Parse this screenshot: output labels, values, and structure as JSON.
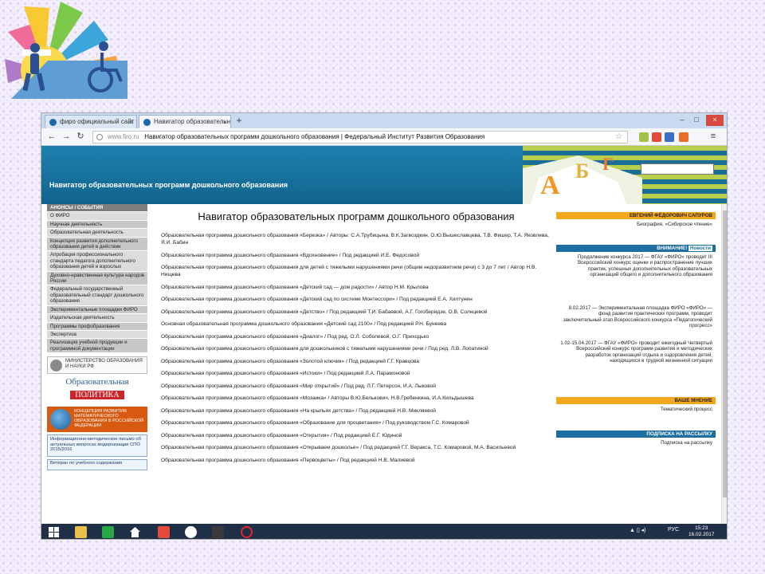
{
  "browser": {
    "tabs": [
      {
        "label": "фиро официальный сайт ©"
      },
      {
        "label": "Навигатор образовательн"
      }
    ],
    "url_domain": "www.firo.ru",
    "url_title": "Навигатор образовательных программ дошкольного образования | Федеральный Институт Развития Образования"
  },
  "site": {
    "header_title": "Навигатор образовательных программ дошкольного образования"
  },
  "sidebar": {
    "items": [
      {
        "label": "АНОНСЫ / СОБЫТИЯ",
        "style": "head"
      },
      {
        "label": "О ФИРО",
        "style": "normal"
      },
      {
        "label": "Научная деятельность",
        "style": "alt"
      },
      {
        "label": "Образовательная деятельность",
        "style": "normal"
      },
      {
        "label": "Концепция развития дополнительного образования детей в действии",
        "style": "alt"
      },
      {
        "label": "Апробация профессионального стандарта педагога дополнительного образования детей и взрослых",
        "style": "normal"
      },
      {
        "label": "Духовно-нравственная культура народов России",
        "style": "alt"
      },
      {
        "label": "Федеральный государственный образовательный стандарт дошкольного образования",
        "style": "normal"
      },
      {
        "label": "Экспериментальные площадки ФИРО",
        "style": "alt"
      },
      {
        "label": "Издательская деятельность",
        "style": "normal"
      },
      {
        "label": "Программы профобразования",
        "style": "alt"
      },
      {
        "label": "Экспертиза",
        "style": "normal"
      },
      {
        "label": "Реализация учебной продукции и программной документации",
        "style": "alt"
      }
    ],
    "ministry": "МИНИСТЕРСТВО ОБРАЗОВАНИЯ И НАУКИ РФ",
    "politika_1": "Образовательная",
    "politika_2": "ПОЛИТИКА",
    "globe_text": "КОНЦЕПЦИЯ РАЗВИТИЯ МАТЕМАТИЧЕСКОГО ОБРАЗОВАНИЯ В РОССИЙСКОЙ ФЕДЕРАЦИИ",
    "info_1": "Информационно-методическое письмо об актуальных вопросах модернизации СПО 2015/2016",
    "info_2": "Ветеран по учебного содержания"
  },
  "main": {
    "title": "Навигатор образовательных программ дошкольного образования",
    "programs": [
      "Образовательная программа дошкольного образования «Березка» / Авторы: С.А.Трубицына, В.К.Загвоздкин, О.Ю.Вышеславцева, Т.В. Фишер, Т.А. Яковлева, Я.И. Бабин",
      "Образовательная программа дошкольного образования «Вдохновение» / Под редакцией И.Е. Федосовой",
      "Образовательная программа дошкольного образования для детей с тяжелыми нарушениями речи (общим недоразвитием речи) с 3 до 7 лет / Автор Н.В. Нищева",
      "Образовательная программа дошкольного образования «Детский сад — дом радости» / Автор Н.М. Крылова",
      "Образовательная программа дошкольного образования «Детский сад по системе Монтессори» / Под редакцией Е.А. Хилтунен",
      "Образовательная программа дошкольного образования «Детство» / Под редакцией Т.И. Бабаевой, А.Г. Гогоберидзе, О.В. Солнцевой",
      "Основная образовательная программа дошкольного образования «Детский сад 2100» / Под редакцией Р.Н. Бунеева",
      "Образовательная программа дошкольного образования «Диалог» / Под ред. О.Л. Соболевой, О.Г. Приходько",
      "Образовательная программа дошкольного образования для дошкольников с тяжелыми нарушениями речи / Под ред. Л.В. Лопатиной",
      "Образовательная программа дошкольного образования «Золотой ключик» / Под редакцией Г.Г. Кравцова",
      "Образовательная программа дошкольного образования «Истоки» / Под редакцией Л.А. Парамоновой",
      "Образовательная программа дошкольного образования «Мир открытий» / Под ред. Л.Г. Петерсон, И.А. Лыковой",
      "Образовательная программа дошкольного образования «Мозаика» / Авторы В.Ю.Белькович, Н.В.Гребенкина, И.А.Кильдышева",
      "Образовательная программа дошкольного образования «На крыльях детства» / Под редакцией Н.В. Микляевой",
      "Образовательная программа дошкольного образования «Образование для процветания» / Под руководством Г.С. Комаровой",
      "Образовательная программа дошкольного образования «Открытия» / Под редакцией Е.Г. Юдиной",
      "Образовательная программа дошкольного образования «Открываем дошколье» / Под редакцией Г.Г. Веракса, Т.С. Комаровой, М.А. Васильевой",
      "Образовательная программа дошкольного образования «Первоцветы» / Под редакцией Н.В. Малиевой"
    ]
  },
  "right": {
    "head_1": "ЕВГЕНИЙ ФЁДОРОВИЧ САПУРОВ",
    "text_1": "Биография, «Сибирское чтение»",
    "head_2": "ВНИМАНИЕ!",
    "head_2_link": "Новости",
    "text_2": "Продолжение конкурса 2017 — ФГАУ «ФИРО» проводит III Всероссийский конкурс оценки и распространение лучших практик, успешных дополнительных образовательных организаций общего и дополнительного образования",
    "text_3": "8.02.2017 — Экспериментальная площадка ФИРО «ФИРО» — фонд развития практических программ, проводит заключительный этап Всероссийского конкурса «Педагогический прогресс»",
    "text_4": "1.02-15.04.2017 — ФГАУ «ФИРО» проводит ежегодный Четвертый Всероссийский конкурс программ развития и методических разработок организаций отдыха и оздоровления детей, находящихся в трудной жизненной ситуации",
    "head_3": "ВАШЕ МНЕНИЕ",
    "text_5": "Тематический процесс",
    "head_4": "ПОДПИСКА НА РАССЫЛКУ",
    "text_6": "Подписка на рассылку"
  },
  "taskbar": {
    "lang": "РУС",
    "time": "15:23",
    "date": "16.02.2017"
  },
  "colors": {
    "header_blue": "#1d80ae",
    "accent_orange": "#f2a81d",
    "accent_blue": "#1d6ea1",
    "sidebar_grey": "#dcdcdc"
  }
}
